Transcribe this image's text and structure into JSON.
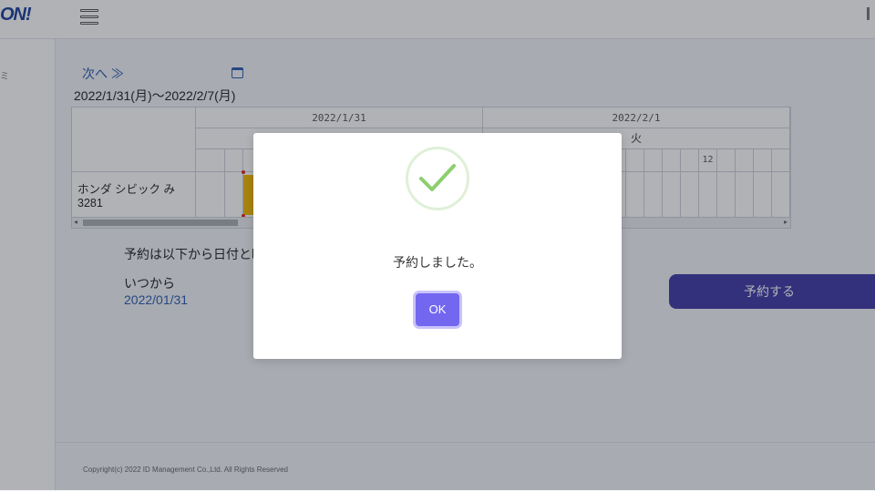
{
  "header": {
    "logo_text": "ON!",
    "menu_icon": "hamburger-icon"
  },
  "sidebar": {
    "glyph": "ミ"
  },
  "navigation": {
    "next_label": "次へ ≫",
    "calendar_icon": "calendar-icon"
  },
  "schedule": {
    "range_label": "2022/1/31(月)～2022/2/7(月)",
    "dates": [
      {
        "label": "2022/1/31",
        "weekday": ""
      },
      {
        "label": "2022/2/1",
        "weekday": "火"
      }
    ],
    "hour_labels": {
      "twelve": "12"
    },
    "vehicles": [
      {
        "name": "ホンダ シビック み3281"
      }
    ],
    "booking_color": "#f2b800"
  },
  "form": {
    "instruction": "予約は以下から日付と時刻",
    "from_label": "いつから",
    "from_value": "2022/01/31",
    "submit_label": "予約する"
  },
  "footer": {
    "copyright": "Copyright(c) 2022 ID Management Co.,Ltd. All Rights Reserved"
  },
  "modal": {
    "icon": "success-check-icon",
    "message": "予約しました。",
    "ok_label": "OK",
    "accent": "#7367f0",
    "success_color": "#8ccf6e"
  }
}
